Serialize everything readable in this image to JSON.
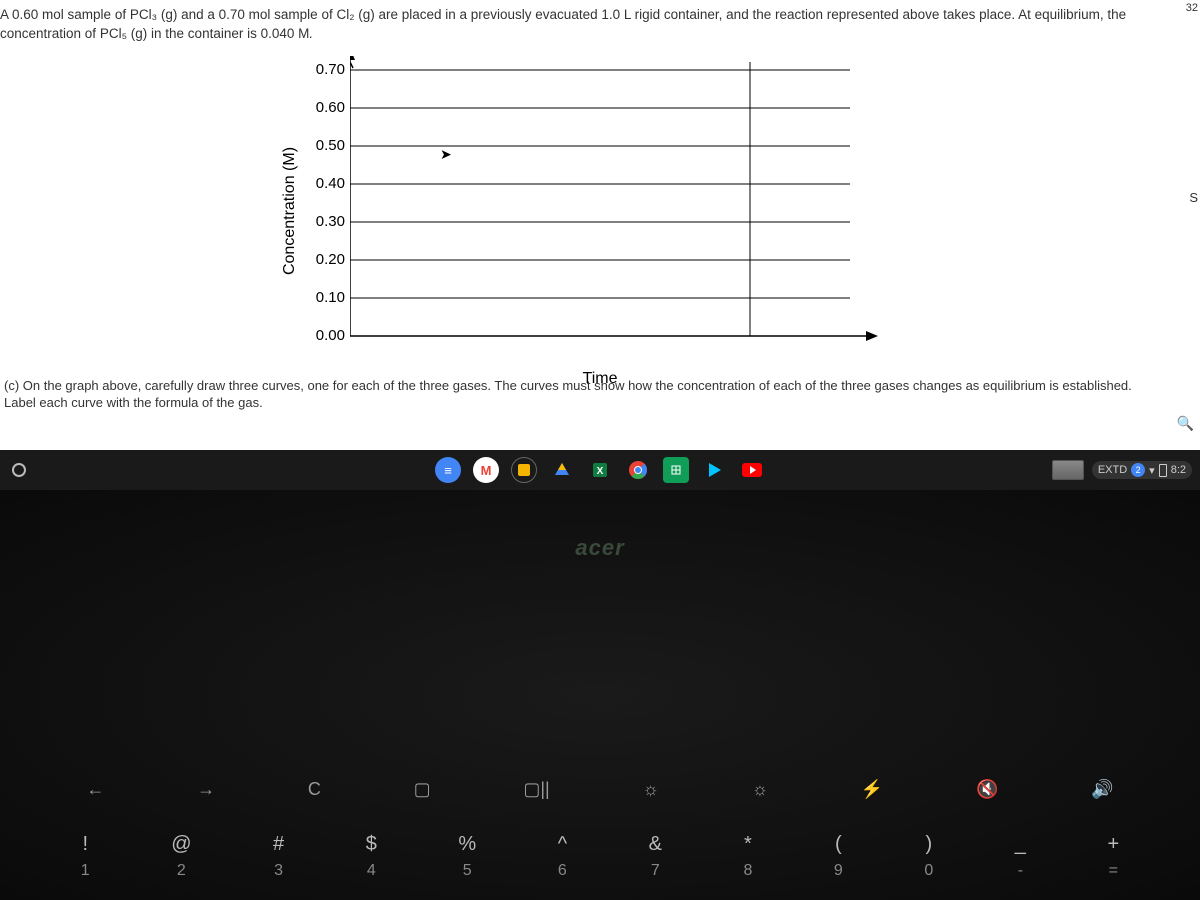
{
  "top_right": "32",
  "problem": {
    "line1_pre": "A ",
    "line1_val1": "0.60 mol",
    "line1_mid1": " sample of ",
    "line1_f1": "PCl₃ (g)",
    "line1_mid2": " and a ",
    "line1_val2": "0.70 mol",
    "line1_mid3": " sample of ",
    "line1_f2": "Cl₂ (g)",
    "line1_mid4": " are placed in a previously evacuated ",
    "line1_val3": "1.0 L",
    "line1_end": " rigid container, and the reaction represented above takes place. At equilibrium, the",
    "line2_pre": "concentration of ",
    "line2_f1": "PCl₅ (g)",
    "line2_mid": " in the container is ",
    "line2_val": "0.040 M",
    "line2_end": "."
  },
  "chart_data": {
    "type": "line",
    "xlabel": "Time",
    "ylabel": "Concentration (M)",
    "ylim": [
      0.0,
      0.7
    ],
    "yticks": [
      "0.70",
      "0.60",
      "0.50",
      "0.40",
      "0.30",
      "0.20",
      "0.10",
      "0.00"
    ],
    "series": []
  },
  "question_c": {
    "line1": "(c) On the graph above, carefully draw three curves, one for each of the three gases. The curves must show how the concentration of each of the three gases changes as equilibrium is established.",
    "line2": "Label each curve with the formula of the gas."
  },
  "right_edge": "S",
  "taskbar": {
    "extd": "EXTD",
    "notif": "2",
    "time": "8:2"
  },
  "laptop": {
    "brand": "acer",
    "fn_keys": [
      "←",
      "→",
      "C",
      "▢",
      "▢||",
      "☼",
      "☼",
      "⚡",
      "🔇",
      "🔊"
    ],
    "num_keys": [
      {
        "sym": "!",
        "num": "1"
      },
      {
        "sym": "@",
        "num": "2"
      },
      {
        "sym": "#",
        "num": "3"
      },
      {
        "sym": "$",
        "num": "4"
      },
      {
        "sym": "%",
        "num": "5"
      },
      {
        "sym": "^",
        "num": "6"
      },
      {
        "sym": "&",
        "num": "7"
      },
      {
        "sym": "*",
        "num": "8"
      },
      {
        "sym": "(",
        "num": "9"
      },
      {
        "sym": ")",
        "num": "0"
      },
      {
        "sym": "_",
        "num": "-"
      },
      {
        "sym": "+",
        "num": "="
      }
    ]
  }
}
